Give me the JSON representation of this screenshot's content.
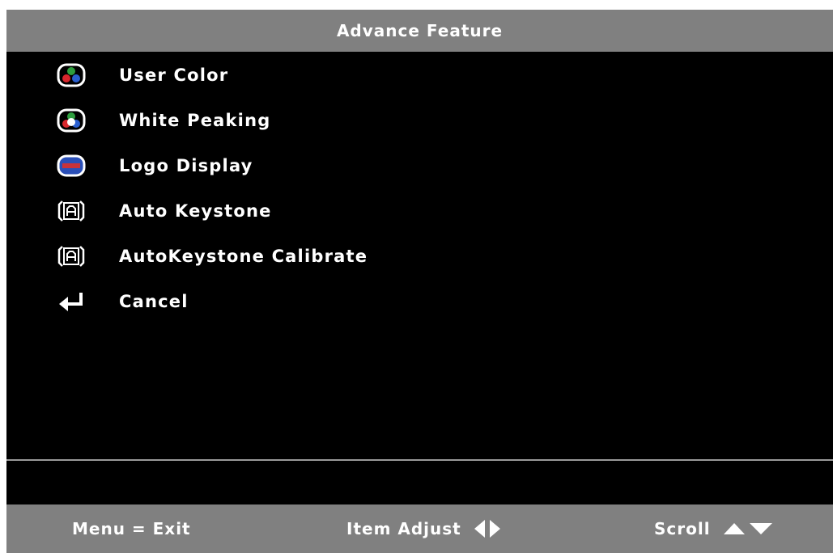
{
  "header": {
    "title": "Advance Feature"
  },
  "menu": {
    "items": [
      {
        "label": "User Color",
        "icon": "user-color-icon"
      },
      {
        "label": "White Peaking",
        "icon": "white-peaking-icon"
      },
      {
        "label": "Logo Display",
        "icon": "logo-display-icon"
      },
      {
        "label": "Auto Keystone",
        "icon": "auto-keystone-icon"
      },
      {
        "label": "AutoKeystone Calibrate",
        "icon": "autokeystone-calibrate-icon"
      },
      {
        "label": "Cancel",
        "icon": "return-arrow-icon"
      }
    ]
  },
  "footer": {
    "exit_hint": "Menu = Exit",
    "adjust_hint": "Item Adjust",
    "scroll_hint": "Scroll"
  },
  "colors": {
    "bar_gray": "#808080",
    "background": "#000000",
    "text": "#ffffff"
  }
}
